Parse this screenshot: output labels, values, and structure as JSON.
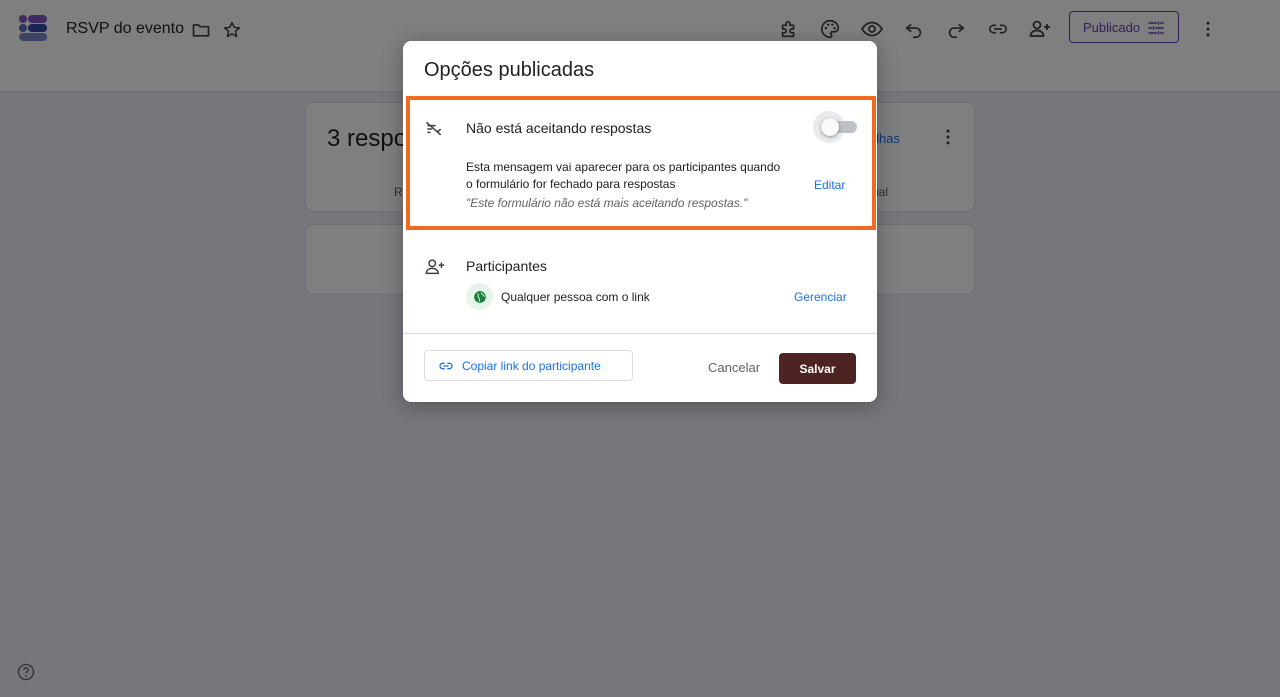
{
  "app": {
    "doc_title": "RSVP do evento",
    "publish_button_label": "Publicado"
  },
  "background": {
    "responses_heading": "3 respo",
    "sheets_link_fragment": "nilhas",
    "tab_left_fragment": "R",
    "tab_right_fragment": "ual"
  },
  "dialog": {
    "title": "Opções publicadas",
    "accepting": {
      "title": "Não está aceitando respostas",
      "toggle_on": false,
      "message": "Esta mensagem vai aparecer para os participantes quando o formulário for fechado para respostas",
      "quote": "\"Este formulário não está mais aceitando respostas.\"",
      "edit_label": "Editar"
    },
    "participants": {
      "title": "Participantes",
      "audience": "Qualquer pessoa com o link",
      "manage_label": "Gerenciar"
    },
    "footer": {
      "copy_link_label": "Copiar link do participante",
      "cancel_label": "Cancelar",
      "save_label": "Salvar"
    }
  },
  "colors": {
    "accent": "#673ab7",
    "link": "#1a73e8",
    "save_button": "#4e2422",
    "highlight_border": "#f26a21"
  },
  "icons": [
    "forms-logo",
    "folder-icon",
    "star-icon",
    "addon-icon",
    "palette-icon",
    "eye-icon",
    "undo-icon",
    "redo-icon",
    "link-icon",
    "add-person-icon",
    "tune-icon",
    "more-vert-icon",
    "no-responses-icon",
    "person-add-icon",
    "globe-icon",
    "help-icon"
  ]
}
